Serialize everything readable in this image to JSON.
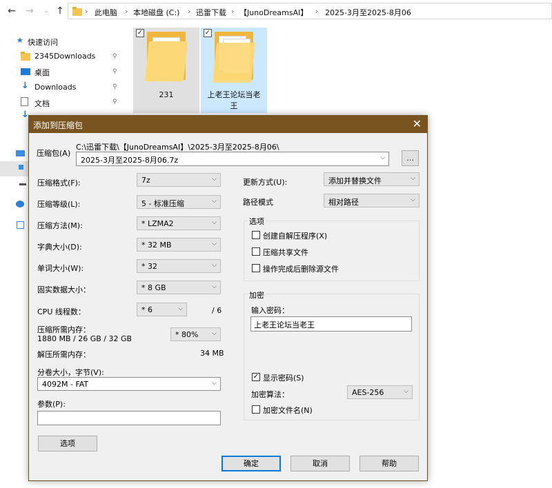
{
  "explorer": {
    "nav": {
      "back": "←",
      "forward": "→",
      "dropdown": "⌄",
      "up": "↑"
    },
    "breadcrumb": [
      "此电脑",
      "本地磁盘 (C:)",
      "迅雷下载",
      "【JunoDreamsAI】",
      "2025-3月至2025-8月06"
    ],
    "sidebar": {
      "quick_access": "快速访问",
      "items": [
        "2345Downloads",
        "桌面",
        "Downloads",
        "文档",
        "Downloads"
      ]
    },
    "files": [
      {
        "name": "231"
      },
      {
        "name_line1": "上老王论坛当老",
        "name_line2": "王"
      }
    ]
  },
  "dialog": {
    "title": "添加到压缩包",
    "close": "✕",
    "archive_label": "压缩包(A)",
    "archive_path": "C:\\迅雷下载\\【JunoDreamsAI】\\2025-3月至2025-8月06\\",
    "archive_name": "2025-3月至2025-8月06.7z",
    "browse_label": "...",
    "format_label": "压缩格式(F):",
    "format_value": "7z",
    "level_label": "压缩等级(L):",
    "level_value": "5 - 标准压缩",
    "method_label": "压缩方法(M):",
    "method_value": "* LZMA2",
    "dict_label": "字典大小(D):",
    "dict_value": "* 32 MB",
    "word_label": "单词大小(W):",
    "word_value": "* 32",
    "solid_label": "固实数据大小：",
    "solid_value": "* 8 GB",
    "cpu_label": "CPU 线程数：",
    "cpu_value": "* 6",
    "cpu_total": "/ 6",
    "mem_comp_label": "压缩所需内存：",
    "mem_comp_detail": "1880 MB / 26 GB / 32 GB",
    "mem_comp_value": "* 80%",
    "mem_decomp_label": "解压所需内存：",
    "mem_decomp_value": "34 MB",
    "volume_label": "分卷大小，字节(V):",
    "volume_value": "4092M - FAT",
    "params_label": "参数(P):",
    "params_value": "",
    "options_button": "选项",
    "update_label": "更新方式(U):",
    "update_value": "添加并替换文件",
    "path_label": "路径模式",
    "path_value": "相对路径",
    "options_group": "选项",
    "opt_sfx": "创建自解压程序(X)",
    "opt_shared": "压缩共享文件",
    "opt_delete": "操作完成后删除源文件",
    "encrypt_group": "加密",
    "password_label": "输入密码：",
    "password_value": "上老王论坛当老王",
    "show_password": "显示密码(S)",
    "encrypt_method_label": "加密算法：",
    "encrypt_method_value": "AES-256",
    "encrypt_names": "加密文件名(N)",
    "ok": "确定",
    "cancel": "取消",
    "help": "帮助",
    "check_mark": "✓",
    "dropdown_arrow": "⌵"
  }
}
